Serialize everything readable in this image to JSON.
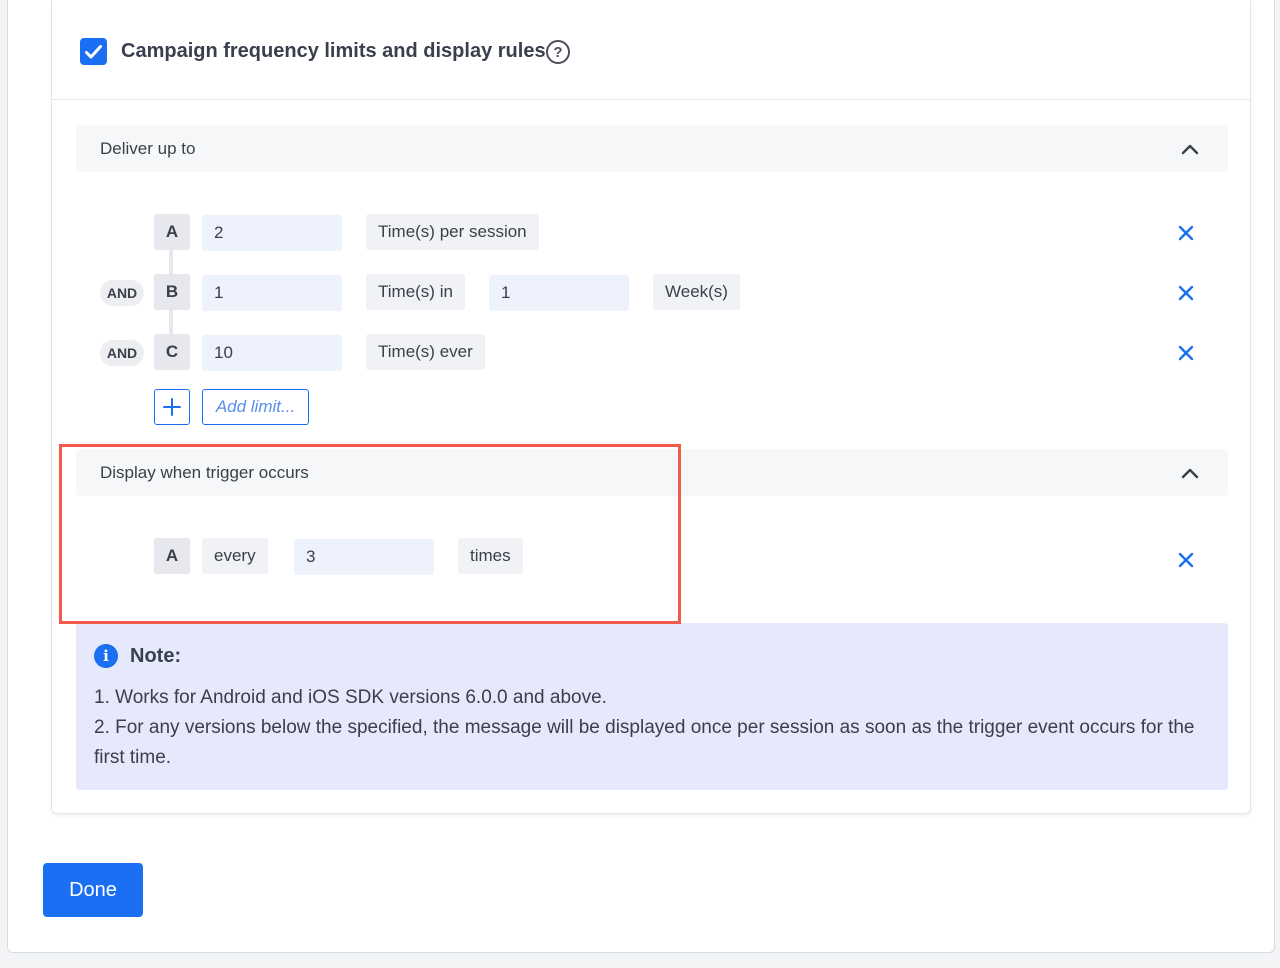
{
  "header": {
    "checked": true,
    "title": "Campaign frequency limits and display rules",
    "help_icon": "question-circle-icon"
  },
  "deliver_section": {
    "label": "Deliver up to",
    "expanded": true,
    "limits": [
      {
        "letter": "A",
        "connector": "",
        "value": "2",
        "unit": "Time(s) per session"
      },
      {
        "letter": "B",
        "connector": "AND",
        "value": "1",
        "unit": "Time(s) in",
        "period_value": "1",
        "period_unit": "Week(s)"
      },
      {
        "letter": "C",
        "connector": "AND",
        "value": "10",
        "unit": "Time(s) ever"
      }
    ],
    "add_limit_placeholder": "Add limit..."
  },
  "trigger_section": {
    "label": "Display when trigger occurs",
    "expanded": true,
    "rule": {
      "letter": "A",
      "prefix": "every",
      "value": "3",
      "suffix": "times"
    }
  },
  "note": {
    "title": "Note:",
    "lines": [
      "1. Works for Android and iOS SDK versions 6.0.0 and above.",
      "2. For any versions below the specified, the message will be displayed once per session as soon as the trigger event occurs for the first time."
    ]
  },
  "done_label": "Done",
  "colors": {
    "accent": "#1a6ff2",
    "highlight_border": "#f25a4d",
    "note_bg": "#e6e8fb"
  }
}
